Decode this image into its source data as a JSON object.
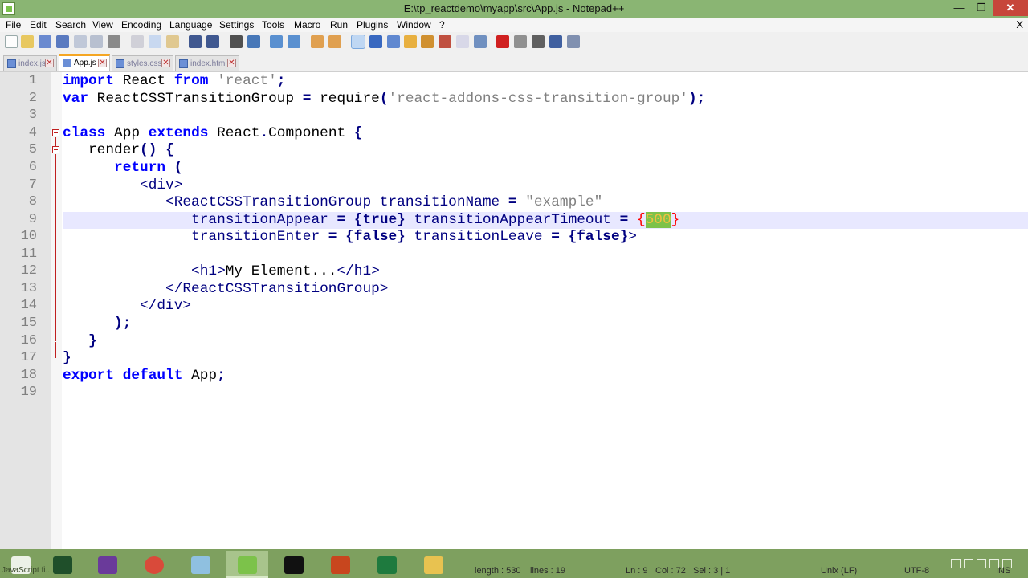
{
  "window": {
    "title": "E:\\tp_reactdemo\\myapp\\src\\App.js - Notepad++",
    "min": "—",
    "max": "❐",
    "close": "✕"
  },
  "menu": [
    "File",
    "Edit",
    "Search",
    "View",
    "Encoding",
    "Language",
    "Settings",
    "Tools",
    "Macro",
    "Run",
    "Plugins",
    "Window",
    "?"
  ],
  "menu_close": "X",
  "tabs": [
    {
      "label": "index.js",
      "active": false
    },
    {
      "label": "App.js",
      "active": true
    },
    {
      "label": "styles.css",
      "active": false
    },
    {
      "label": "index.html",
      "active": false
    }
  ],
  "tab_close": "✕",
  "editor": {
    "line_numbers": [
      "1",
      "2",
      "3",
      "4",
      "5",
      "6",
      "7",
      "8",
      "9",
      "10",
      "11",
      "12",
      "13",
      "14",
      "15",
      "16",
      "17",
      "18",
      "19"
    ],
    "code": {
      "l1_a": "import",
      "l1_b": " React ",
      "l1_c": "from",
      "l1_d": " ",
      "l1_e": "'react'",
      "l1_f": ";",
      "l2_a": "var",
      "l2_b": " ReactCSSTransitionGroup ",
      "l2_c": "=",
      "l2_d": " require",
      "l2_e": "(",
      "l2_f": "'react-addons-css-transition-group'",
      "l2_g": ");",
      "l4_a": "class",
      "l4_b": " App ",
      "l4_c": "extends",
      "l4_d": " React",
      "l4_e": ".",
      "l4_f": "Component ",
      "l4_g": "{",
      "l5_a": "   render",
      "l5_b": "()",
      "l5_c": " ",
      "l5_d": "{",
      "l6_a": "      ",
      "l6_b": "return",
      "l6_c": " ",
      "l6_d": "(",
      "l7_a": "         ",
      "l7_b": "<div>",
      "l8_a": "            ",
      "l8_b": "<ReactCSSTransitionGroup transitionName ",
      "l8_c": "=",
      "l8_d": " ",
      "l8_e": "\"example\"",
      "l9_a": "               ",
      "l9_b": "transitionAppear ",
      "l9_c": "=",
      "l9_d": " ",
      "l9_e": "{true}",
      "l9_f": " transitionAppearTimeout ",
      "l9_g": "=",
      "l9_h": " ",
      "l9_i": "{",
      "l9_j": "500",
      "l9_k": "}",
      "l10_a": "               ",
      "l10_b": "transitionEnter ",
      "l10_c": "=",
      "l10_d": " ",
      "l10_e": "{false}",
      "l10_f": " transitionLeave ",
      "l10_g": "=",
      "l10_h": " ",
      "l10_i": "{false}",
      "l10_j": ">",
      "l12_a": "               ",
      "l12_b": "<h1>",
      "l12_c": "My Element...",
      "l12_d": "</h1>",
      "l13_a": "            ",
      "l13_b": "</ReactCSSTransitionGroup>",
      "l14_a": "         ",
      "l14_b": "</div>",
      "l15_a": "      ",
      "l15_b": ");",
      "l16_a": "   ",
      "l16_b": "}",
      "l17_a": "}",
      "l18_a": "export",
      "l18_b": " ",
      "l18_c": "default",
      "l18_d": " App",
      "l18_e": ";"
    }
  },
  "status": {
    "lang": "JavaScript fi...",
    "length": "length : 530",
    "lines": "lines : 19",
    "ln": "Ln : 9",
    "col": "Col : 72",
    "sel": "Sel : 3 | 1",
    "eol": "Unix (LF)",
    "enc": "UTF-8",
    "ins": "INS"
  },
  "taskbar": [
    "start-icon",
    "codeblocks-icon",
    "visual-studio-icon",
    "chrome-icon",
    "notepad-icon",
    "notepadpp-icon",
    "cmd-icon",
    "powerpoint-icon",
    "excel-icon",
    "file-explorer-icon"
  ],
  "colors": {
    "accent": "#8ab573",
    "keyword": "#0000ff",
    "string": "#808080",
    "operator": "#000080",
    "brace_match": "#ff0000"
  }
}
